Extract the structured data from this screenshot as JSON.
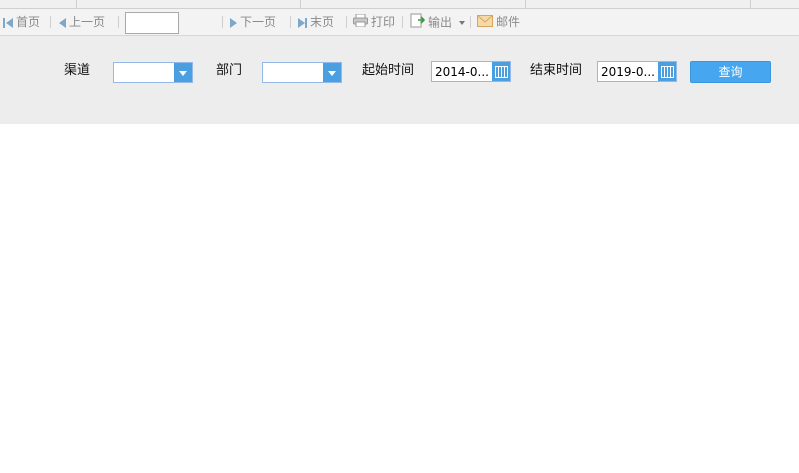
{
  "toolbar": {
    "first": "首页",
    "prev": "上一页",
    "page_value": "",
    "next": "下一页",
    "last": "末页",
    "print": "打印",
    "export": "输出",
    "mail": "邮件"
  },
  "filters": {
    "channel_label": "渠道",
    "channel_value": "",
    "dept_label": "部门",
    "dept_value": "",
    "start_label": "起始时间",
    "start_value": "2014-0...",
    "end_label": "结束时间",
    "end_value": "2019-0...",
    "query_button": "查询"
  },
  "colors": {
    "accent": "#46a6f0",
    "toolbar_text": "#8a8a8a"
  }
}
